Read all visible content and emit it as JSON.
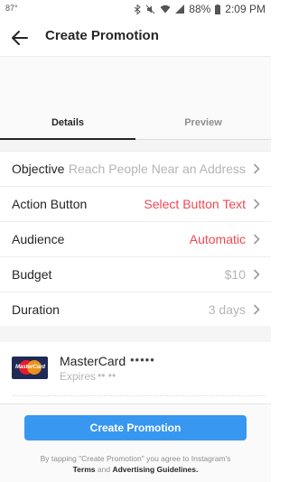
{
  "status_bar": {
    "left_indicator": "87°",
    "battery": "88%",
    "time": "2:09 PM"
  },
  "header": {
    "title": "Create Promotion",
    "back_icon": "back-arrow-icon"
  },
  "tabs": [
    {
      "label": "Details",
      "active": true
    },
    {
      "label": "Preview",
      "active": false
    }
  ],
  "settings": [
    {
      "label": "Objective",
      "value": "Reach People Near an Address",
      "value_style": "gray"
    },
    {
      "label": "Action Button",
      "value": "Select Button Text",
      "value_style": "red"
    },
    {
      "label": "Audience",
      "value": "Automatic",
      "value_style": "red"
    },
    {
      "label": "Budget",
      "value": "$10",
      "value_style": "gray"
    },
    {
      "label": "Duration",
      "value": "3 days",
      "value_style": "gray"
    }
  ],
  "payment": {
    "card_name": "MasterCard",
    "masked_number": "•••••",
    "expires_label": "Expires",
    "expires_masked": "•• ••"
  },
  "footer": {
    "cta_label": "Create Promotion",
    "legal_line1": "By tapping \"Create Promotion\" you agree to Instagram's",
    "terms": "Terms",
    "and": "and",
    "guidelines": "Advertising Guidelines."
  },
  "colors": {
    "accent_blue": "#3897f0",
    "accent_red": "#ed4956",
    "muted_gray": "#b5b5b5"
  }
}
